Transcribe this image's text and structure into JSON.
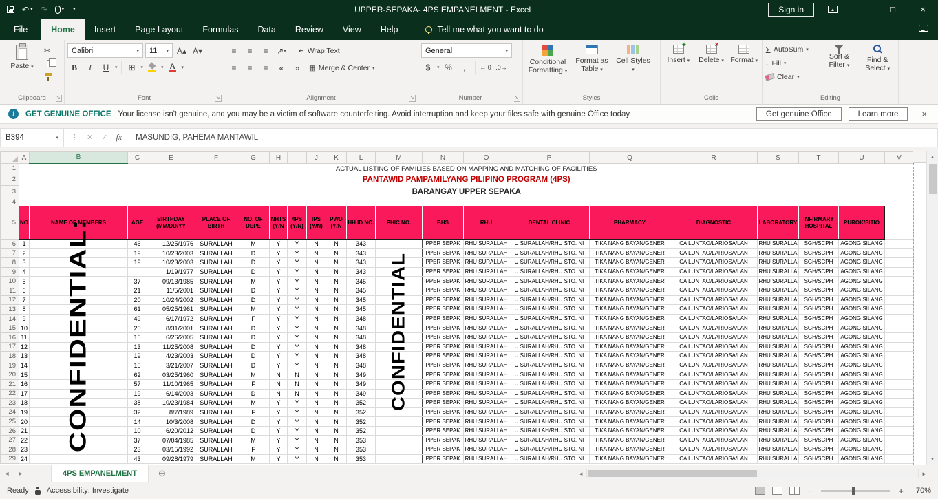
{
  "colors": {
    "titlebar_bg": "#0a301d",
    "accent_green": "#217346",
    "header_pink": "#fa1a5b",
    "title_red": "#c00000"
  },
  "title_bar": {
    "title": "UPPER-SEPAKA- 4PS EMPANELMENT - Excel",
    "sign_in_label": "Sign in"
  },
  "ribbon_tabs": {
    "items": [
      "File",
      "Home",
      "Insert",
      "Page Layout",
      "Formulas",
      "Data",
      "Review",
      "View",
      "Help"
    ],
    "active": "Home",
    "tell_me": "Tell me what you want to do"
  },
  "ribbon": {
    "clipboard": {
      "label": "Clipboard",
      "paste": "Paste"
    },
    "font": {
      "label": "Font",
      "font_name": "Calibri",
      "font_size": "11"
    },
    "alignment": {
      "label": "Alignment",
      "wrap_text": "Wrap Text",
      "merge_center": "Merge & Center"
    },
    "number": {
      "label": "Number",
      "format": "General"
    },
    "styles": {
      "label": "Styles",
      "conditional": "Conditional Formatting",
      "format_table": "Format as Table",
      "cell_styles": "Cell Styles"
    },
    "cells": {
      "label": "Cells",
      "insert": "Insert",
      "delete": "Delete",
      "format": "Format"
    },
    "editing": {
      "label": "Editing",
      "autosum": "AutoSum",
      "fill": "Fill",
      "clear": "Clear",
      "sort_filter": "Sort & Filter",
      "find_select": "Find & Select"
    }
  },
  "notice": {
    "brand": "GET GENUINE OFFICE",
    "message": "Your license isn't genuine, and you may be a victim of software counterfeiting. Avoid interruption and keep your files safe with genuine Office today.",
    "get_genuine_label": "Get genuine Office",
    "learn_more_label": "Learn more"
  },
  "formula_bar": {
    "name_box": "B394",
    "fx_label": "fx",
    "value": "MASUNDIG, PAHEMA MANTAWIL"
  },
  "sheet": {
    "column_letters": [
      "A",
      "B",
      "C",
      "E",
      "F",
      "G",
      "H",
      "I",
      "J",
      "K",
      "L",
      "M",
      "N",
      "O",
      "P",
      "Q",
      "R",
      "S",
      "T",
      "U",
      "V"
    ],
    "selected_column": "B",
    "title_rows": {
      "row1": "ACTUAL LISTING OF FAMILIES BASED ON MAPPING AND MATCHING OF FACILITIES",
      "row2": "PANTAWID PAMPAMILYANG PILIPINO PROGRAM (4PS)",
      "row3": "BARANGAY UPPER SEPAKA"
    },
    "watermark_names": "CONFIDENTIAL:",
    "watermark_phic": "CONFIDENTIAL",
    "columns": [
      {
        "col": "A",
        "header": "NO.",
        "field": "no"
      },
      {
        "col": "B",
        "header": "NAME OF MEMBERS",
        "field": "name"
      },
      {
        "col": "C",
        "header": "AGE",
        "field": "age"
      },
      {
        "col": "E",
        "header": "BIRTHDAY (MM/DD/YY",
        "field": "birthday"
      },
      {
        "col": "F",
        "header": "PLACE OF BIRTH",
        "field": "place"
      },
      {
        "col": "G",
        "header": "NO. OF DEPE",
        "field": "depe"
      },
      {
        "col": "H",
        "header": "NHTS (Y/N",
        "field": "nhts"
      },
      {
        "col": "I",
        "header": "4PS (Y/N)",
        "field": "fourps"
      },
      {
        "col": "J",
        "header": "IPS (Y/N)",
        "field": "ips"
      },
      {
        "col": "K",
        "header": "PWD (Y/N",
        "field": "pwd"
      },
      {
        "col": "L",
        "header": "HH ID NO.",
        "field": "hhid"
      },
      {
        "col": "M",
        "header": "PHIC NO.",
        "field": "phic"
      },
      {
        "col": "N",
        "header": "BHS",
        "field": "bhs"
      },
      {
        "col": "O",
        "header": "RHU",
        "field": "rhu"
      },
      {
        "col": "P",
        "header": "DENTAL CLINIC",
        "field": "dental"
      },
      {
        "col": "Q",
        "header": "PHARMACY",
        "field": "pharmacy"
      },
      {
        "col": "R",
        "header": "DIAGNOSTIC",
        "field": "diagnostic"
      },
      {
        "col": "S",
        "header": "LABORATORY",
        "field": "laboratory"
      },
      {
        "col": "T",
        "header": "INFIRMARY HOSPITAL",
        "field": "infirmary"
      },
      {
        "col": "U",
        "header": "PUROK/SITIO",
        "field": "purok"
      },
      {
        "col": "V",
        "header": "",
        "field": ""
      }
    ],
    "facilities_row": {
      "bhs": "PPER SEPAK",
      "rhu": "RHU SURALLAH",
      "dental": "U SURALLAH/RHU STO. NI",
      "pharmacy": "TIKA NANG BAYAN/GENER",
      "diagnostic": "CA LUNTAO/LARIOSA/LAN",
      "laboratory": "RHU SURALLA",
      "infirmary": "SGH/SCPH",
      "purok": "AGONG SILANG"
    },
    "rows": [
      {
        "no": "1",
        "name": "",
        "age": "46",
        "birthday": "12/25/1976",
        "place": "SURALLAH",
        "depe": "M",
        "nhts": "Y",
        "fourps": "Y",
        "ips": "N",
        "pwd": "N",
        "hhid": "343",
        "phic": ""
      },
      {
        "no": "2",
        "name": "",
        "age": "19",
        "birthday": "10/23/2003",
        "place": "SURALLAH",
        "depe": "D",
        "nhts": "Y",
        "fourps": "Y",
        "ips": "N",
        "pwd": "N",
        "hhid": "343",
        "phic": ""
      },
      {
        "no": "3",
        "name": "",
        "age": "19",
        "birthday": "10/23/2003",
        "place": "SURALLAH",
        "depe": "D",
        "nhts": "Y",
        "fourps": "Y",
        "ips": "N",
        "pwd": "N",
        "hhid": "343",
        "phic": ""
      },
      {
        "no": "4",
        "name": "",
        "age": "",
        "birthday": "1/19/1977",
        "place": "SURALLAH",
        "depe": "D",
        "nhts": "Y",
        "fourps": "Y",
        "ips": "N",
        "pwd": "N",
        "hhid": "343",
        "phic": ""
      },
      {
        "no": "5",
        "name": "",
        "age": "37",
        "birthday": "09/13/1985",
        "place": "SURALLAH",
        "depe": "M",
        "nhts": "Y",
        "fourps": "Y",
        "ips": "N",
        "pwd": "N",
        "hhid": "345",
        "phic": ""
      },
      {
        "no": "6",
        "name": "",
        "age": "21",
        "birthday": "11/5/2001",
        "place": "SURALLAH",
        "depe": "D",
        "nhts": "Y",
        "fourps": "Y",
        "ips": "N",
        "pwd": "N",
        "hhid": "345",
        "phic": ""
      },
      {
        "no": "7",
        "name": "",
        "age": "20",
        "birthday": "10/24/2002",
        "place": "SURALLAH",
        "depe": "D",
        "nhts": "Y",
        "fourps": "Y",
        "ips": "N",
        "pwd": "N",
        "hhid": "345",
        "phic": ""
      },
      {
        "no": "8",
        "name": "",
        "age": "61",
        "birthday": "05/25/1961",
        "place": "SURALLAH",
        "depe": "M",
        "nhts": "Y",
        "fourps": "Y",
        "ips": "N",
        "pwd": "N",
        "hhid": "345",
        "phic": ""
      },
      {
        "no": "9",
        "name": "",
        "age": "49",
        "birthday": "6/17/1972",
        "place": "SURALLAH",
        "depe": "F",
        "nhts": "Y",
        "fourps": "Y",
        "ips": "N",
        "pwd": "N",
        "hhid": "348",
        "phic": ""
      },
      {
        "no": "10",
        "name": "",
        "age": "20",
        "birthday": "8/31/2001",
        "place": "SURALLAH",
        "depe": "D",
        "nhts": "Y",
        "fourps": "Y",
        "ips": "N",
        "pwd": "N",
        "hhid": "348",
        "phic": ""
      },
      {
        "no": "11",
        "name": "",
        "age": "16",
        "birthday": "6/26/2005",
        "place": "SURALLAH",
        "depe": "D",
        "nhts": "Y",
        "fourps": "Y",
        "ips": "N",
        "pwd": "N",
        "hhid": "348",
        "phic": ""
      },
      {
        "no": "12",
        "name": "",
        "age": "13",
        "birthday": "11/25/2008",
        "place": "SURALLAH",
        "depe": "D",
        "nhts": "Y",
        "fourps": "Y",
        "ips": "N",
        "pwd": "N",
        "hhid": "348",
        "phic": ""
      },
      {
        "no": "13",
        "name": "",
        "age": "19",
        "birthday": "4/23/2003",
        "place": "SURALLAH",
        "depe": "D",
        "nhts": "Y",
        "fourps": "Y",
        "ips": "N",
        "pwd": "N",
        "hhid": "348",
        "phic": ""
      },
      {
        "no": "14",
        "name": "",
        "age": "15",
        "birthday": "3/21/2007",
        "place": "SURALLAH",
        "depe": "D",
        "nhts": "Y",
        "fourps": "Y",
        "ips": "N",
        "pwd": "N",
        "hhid": "348",
        "phic": ""
      },
      {
        "no": "15",
        "name": "",
        "age": "62",
        "birthday": "03/25/1960",
        "place": "SURALLAH",
        "depe": "M",
        "nhts": "N",
        "fourps": "N",
        "ips": "N",
        "pwd": "N",
        "hhid": "349",
        "phic": ""
      },
      {
        "no": "16",
        "name": "",
        "age": "57",
        "birthday": "11/10/1965",
        "place": "SURALLAH",
        "depe": "F",
        "nhts": "N",
        "fourps": "N",
        "ips": "N",
        "pwd": "N",
        "hhid": "349",
        "phic": ""
      },
      {
        "no": "17",
        "name": "",
        "age": "19",
        "birthday": "6/14/2003",
        "place": "SURALLAH",
        "depe": "D",
        "nhts": "N",
        "fourps": "N",
        "ips": "N",
        "pwd": "N",
        "hhid": "349",
        "phic": ""
      },
      {
        "no": "18",
        "name": "",
        "age": "38",
        "birthday": "10/23/1984",
        "place": "SURALLAH",
        "depe": "M",
        "nhts": "Y",
        "fourps": "Y",
        "ips": "N",
        "pwd": "N",
        "hhid": "352",
        "phic": ""
      },
      {
        "no": "19",
        "name": "",
        "age": "32",
        "birthday": "8/7/1989",
        "place": "SURALLAH",
        "depe": "F",
        "nhts": "Y",
        "fourps": "Y",
        "ips": "N",
        "pwd": "N",
        "hhid": "352",
        "phic": ""
      },
      {
        "no": "20",
        "name": "",
        "age": "14",
        "birthday": "10/3/2008",
        "place": "SURALLAH",
        "depe": "D",
        "nhts": "Y",
        "fourps": "Y",
        "ips": "N",
        "pwd": "N",
        "hhid": "352",
        "phic": ""
      },
      {
        "no": "21",
        "name": "",
        "age": "10",
        "birthday": "6/20/2012",
        "place": "SURALLAH",
        "depe": "D",
        "nhts": "Y",
        "fourps": "Y",
        "ips": "N",
        "pwd": "N",
        "hhid": "352",
        "phic": ""
      },
      {
        "no": "22",
        "name": "",
        "age": "37",
        "birthday": "07/04/1985",
        "place": "SURALLAH",
        "depe": "M",
        "nhts": "Y",
        "fourps": "Y",
        "ips": "N",
        "pwd": "N",
        "hhid": "353",
        "phic": ""
      },
      {
        "no": "23",
        "name": "",
        "age": "23",
        "birthday": "03/15/1992",
        "place": "SURALLAH",
        "depe": "F",
        "nhts": "Y",
        "fourps": "Y",
        "ips": "N",
        "pwd": "N",
        "hhid": "353",
        "phic": ""
      },
      {
        "no": "24",
        "name": "",
        "age": "43",
        "birthday": "09/28/1979",
        "place": "SURALLAH",
        "depe": "M",
        "nhts": "Y",
        "fourps": "Y",
        "ips": "N",
        "pwd": "N",
        "hhid": "353",
        "phic": ""
      }
    ]
  },
  "sheet_tabs": {
    "active_tab": "4PS EMPANELMENT"
  },
  "status_bar": {
    "mode": "Ready",
    "accessibility": "Accessibility: Investigate",
    "zoom_level": "70%"
  }
}
